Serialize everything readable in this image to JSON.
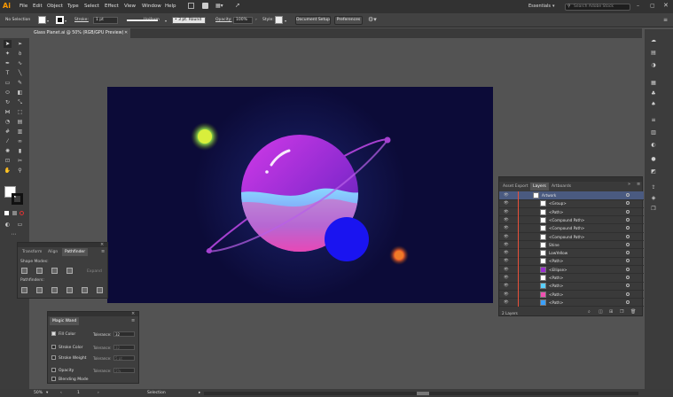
{
  "app": {
    "logo": "Ai"
  },
  "menu": [
    "File",
    "Edit",
    "Object",
    "Type",
    "Select",
    "Effect",
    "View",
    "Window",
    "Help"
  ],
  "workspace": {
    "label": "Essentials",
    "search_placeholder": "Search Adobe Stock"
  },
  "control": {
    "selection_label": "No Selection",
    "stroke_label": "Stroke:",
    "stroke_value": "1 pt",
    "profile_value": "Uniform",
    "brush_value": "3 pt. Round",
    "opacity_label": "Opacity:",
    "opacity_value": "100%",
    "style_label": "Style:",
    "doc_setup": "Document Setup",
    "preferences": "Preferences"
  },
  "document": {
    "tab_title": "Glass Planet.ai @ 50% (RGB/GPU Preview)"
  },
  "pathfinder": {
    "tabs": [
      "Transform",
      "Align",
      "Pathfinder"
    ],
    "shape_modes": "Shape Modes:",
    "expand": "Expand",
    "pathfinders": "Pathfinders:"
  },
  "magic_wand": {
    "title": "Magic Wand",
    "rows": [
      {
        "label": "Fill Color",
        "checked": true,
        "tol_label": "Tolerance:",
        "tol_value": "32"
      },
      {
        "label": "Stroke Color",
        "checked": false,
        "tol_label": "Tolerance:",
        "tol_value": "32"
      },
      {
        "label": "Stroke Weight",
        "checked": false,
        "tol_label": "Tolerance:",
        "tol_value": "5 pt"
      },
      {
        "label": "Opacity",
        "checked": false,
        "tol_label": "Tolerance:",
        "tol_value": "5%"
      },
      {
        "label": "Blending Mode",
        "checked": false
      }
    ]
  },
  "layers": {
    "tabs": [
      "Asset Export",
      "Layers",
      "Artboards"
    ],
    "items": [
      {
        "name": "Artwork",
        "thumb": "#ffffff",
        "top": true
      },
      {
        "name": "<Group>",
        "thumb": "#ffffff"
      },
      {
        "name": "<Path>",
        "thumb": "#ffffff"
      },
      {
        "name": "<Compound Path>",
        "thumb": "#ffffff"
      },
      {
        "name": "<Compound Path>",
        "thumb": "#ffffff"
      },
      {
        "name": "<Compound Path>",
        "thumb": "#ffffff"
      },
      {
        "name": "Shine",
        "thumb": "#ffffff"
      },
      {
        "name": "LowYellow",
        "thumb": "#ffffff"
      },
      {
        "name": "<Path>",
        "thumb": "#ffffff"
      },
      {
        "name": "<Ellipse>",
        "thumb": "#9b2fd1"
      },
      {
        "name": "<Path>",
        "thumb": "#ffffff"
      },
      {
        "name": "<Path>",
        "thumb": "#5ad0ff"
      },
      {
        "name": "<Path>",
        "thumb": "#f050b0"
      },
      {
        "name": "<Path>",
        "thumb": "#3aa0ff"
      }
    ],
    "count": "2 Layers"
  },
  "status": {
    "zoom": "50%",
    "page": "1",
    "tool": "Selection"
  }
}
